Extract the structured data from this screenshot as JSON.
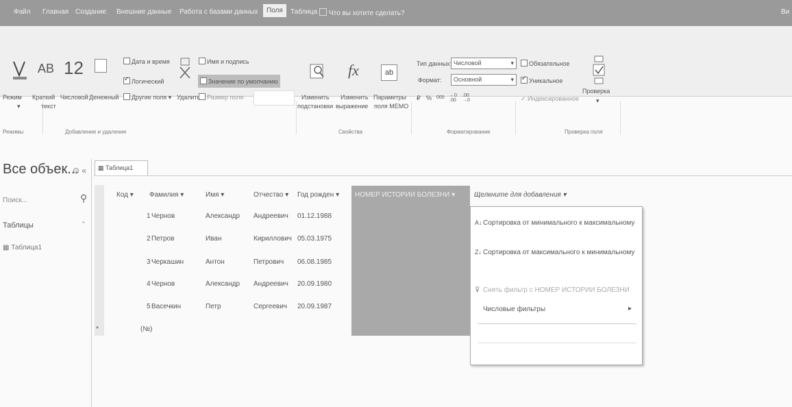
{
  "menu": {
    "tabs": [
      "Файл",
      "Главная",
      "Создание",
      "Внешние данные",
      "Работа с базами данных",
      "Поля",
      "Таблица"
    ],
    "active_tab": "Поля",
    "tell_me": "Что вы хотите сделать?",
    "right_partial": "Ви"
  },
  "ribbon": {
    "views": {
      "mode_label": "Режим",
      "group": "Режимы"
    },
    "add_delete": {
      "short_text_glyph": "AB",
      "number_glyph": "12",
      "short_text_label1": "Краткий",
      "short_text_label2": "текст",
      "number_label": "Числовой",
      "currency_label": "Денежный",
      "datetime": "Дата и время",
      "boolean": "Логический",
      "more_fields": "Другие поля",
      "delete": "Удалить",
      "name_caption": "Имя и подпись",
      "default_value": "Значение по умолчанию",
      "field_size": "Размер поля",
      "group": "Добавление и удаление"
    },
    "properties": {
      "modify_lookups1": "Изменить",
      "modify_lookups2": "подстановки",
      "modify_expr1": "Изменить",
      "modify_expr2": "выражение",
      "memo1": "Параметры",
      "memo2": "поля MEMO",
      "group": "Свойства"
    },
    "formatting": {
      "data_type_label": "Тип данных:",
      "data_type_value": "Числовой",
      "format_label": "Формат:",
      "format_value": "Основной",
      "group": "Форматирование"
    },
    "validation": {
      "required": "Обязательное",
      "unique": "Уникальное",
      "indexed": "Индексированное",
      "check": "Проверка",
      "group": "Проверка поля"
    }
  },
  "nav": {
    "title": "Все объек...",
    "search_placeholder": "Поиск...",
    "section": "Таблицы",
    "item": "Таблица1"
  },
  "doc_tab": "Таблица1",
  "table": {
    "headers": [
      "Код",
      "Фамилия",
      "Имя",
      "Отчество",
      "Год рожден",
      "НОМЕР ИСТОРИИ БОЛЕЗНИ",
      "Щелкните для добавления"
    ],
    "rows": [
      [
        "1",
        "Чернов",
        "Александр",
        "Андреевич",
        "01.12.1988"
      ],
      [
        "2",
        "Петров",
        "Иван",
        "Кириллович",
        "05.03.1975"
      ],
      [
        "3",
        "Черкашин",
        "Антон",
        "Петрович",
        "06.08.1985"
      ],
      [
        "4",
        "Чернов",
        "Александр",
        "Андреевич",
        "20.09.1980"
      ],
      [
        "5",
        "Васечкин",
        "Петр",
        "Сергеевич",
        "20.09.1987"
      ]
    ],
    "new_row_marker": "*",
    "new_row_value": "(№)"
  },
  "context_menu": {
    "items": [
      "Сортировка от минимального к максимальному",
      "Сортировка от максимального к минимальному",
      "Снять фильтр с НОМЕР ИСТОРИИ БОЛЕЗНИ",
      "Числовые фильтры"
    ]
  }
}
